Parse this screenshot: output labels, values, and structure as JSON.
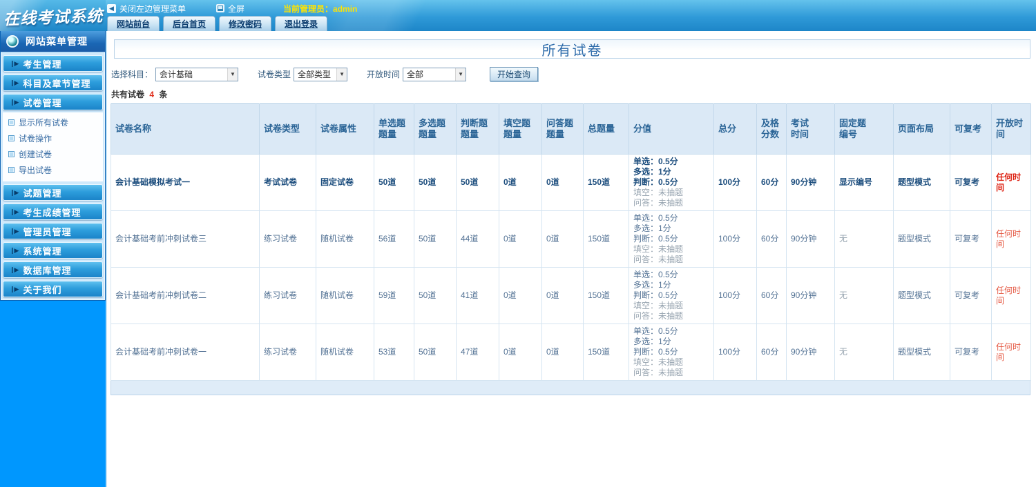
{
  "icons": {
    "menu_arrow": "❙▶",
    "close_menu": "◀",
    "select_arrow": "▼"
  },
  "topbar": {
    "logo": "在线考试系统",
    "close_menu_label": "关闭左边管理菜单",
    "fullscreen_label": "全屏",
    "admin_label": "当前管理员：admin",
    "tabs": [
      "网站前台",
      "后台首页",
      "修改密码",
      "退出登录"
    ]
  },
  "sidebar": {
    "title": "网站菜单管理",
    "items": [
      {
        "label": "考生管理"
      },
      {
        "label": "科目及章节管理"
      },
      {
        "label": "试卷管理",
        "children": [
          "显示所有试卷",
          "试卷操作",
          "创建试卷",
          "导出试卷"
        ]
      },
      {
        "label": "试题管理"
      },
      {
        "label": "考生成绩管理"
      },
      {
        "label": "管理员管理"
      },
      {
        "label": "系统管理"
      },
      {
        "label": "数据库管理"
      },
      {
        "label": "关于我们"
      }
    ]
  },
  "main": {
    "title": "所有试卷",
    "filters": {
      "subject_label": "选择科目：",
      "subject_value": "会计基础",
      "type_label": "试卷类型",
      "type_value": "全部类型",
      "time_label": "开放时间",
      "time_value": "全部",
      "query_button": "开始查询"
    },
    "count": {
      "prefix": "共有试卷",
      "value": "4",
      "suffix": "条"
    }
  },
  "table": {
    "columns": [
      "试卷名称",
      "试卷类型",
      "试卷属性",
      "单选题\n题量",
      "多选题\n题量",
      "判断题\n题量",
      "填空题\n题量",
      "问答题\n题量",
      "总题量",
      "分值",
      "总分",
      "及格\n分数",
      "考试\n时间",
      "固定题\n编号",
      "页面布局",
      "可复考",
      "开放时间"
    ],
    "rows": [
      {
        "bold": true,
        "name": "会计基础模拟考试一",
        "type": "考试试卷",
        "attr": "固定试卷",
        "single": "50道",
        "multi": "50道",
        "judge": "50道",
        "blank": "0道",
        "qa": "0道",
        "total": "150道",
        "score_lines": [
          "单选：0.5分",
          "多选：1分",
          "判断：0.5分"
        ],
        "score_muted": [
          "填空：未抽题",
          "问答：未抽题"
        ],
        "total_score": "100分",
        "pass_score": "60分",
        "time": "90分钟",
        "fixed_no": "显示编号",
        "fixed_no_muted": false,
        "layout": "题型模式",
        "retake": "可复考",
        "open_time": "任何时间"
      },
      {
        "bold": false,
        "name": "会计基础考前冲刺试卷三",
        "type": "练习试卷",
        "attr": "随机试卷",
        "single": "56道",
        "multi": "50道",
        "judge": "44道",
        "blank": "0道",
        "qa": "0道",
        "total": "150道",
        "score_lines": [
          "单选：0.5分",
          "多选：1分",
          "判断：0.5分"
        ],
        "score_muted": [
          "填空：未抽题",
          "问答：未抽题"
        ],
        "total_score": "100分",
        "pass_score": "60分",
        "time": "90分钟",
        "fixed_no": "无",
        "fixed_no_muted": true,
        "layout": "题型模式",
        "retake": "可复考",
        "open_time": "任何时间"
      },
      {
        "bold": false,
        "name": "会计基础考前冲刺试卷二",
        "type": "练习试卷",
        "attr": "随机试卷",
        "single": "59道",
        "multi": "50道",
        "judge": "41道",
        "blank": "0道",
        "qa": "0道",
        "total": "150道",
        "score_lines": [
          "单选：0.5分",
          "多选：1分",
          "判断：0.5分"
        ],
        "score_muted": [
          "填空：未抽题",
          "问答：未抽题"
        ],
        "total_score": "100分",
        "pass_score": "60分",
        "time": "90分钟",
        "fixed_no": "无",
        "fixed_no_muted": true,
        "layout": "题型模式",
        "retake": "可复考",
        "open_time": "任何时间"
      },
      {
        "bold": false,
        "name": "会计基础考前冲刺试卷一",
        "type": "练习试卷",
        "attr": "随机试卷",
        "single": "53道",
        "multi": "50道",
        "judge": "47道",
        "blank": "0道",
        "qa": "0道",
        "total": "150道",
        "score_lines": [
          "单选：0.5分",
          "多选：1分",
          "判断：0.5分"
        ],
        "score_muted": [
          "填空：未抽题",
          "问答：未抽题"
        ],
        "total_score": "100分",
        "pass_score": "60分",
        "time": "90分钟",
        "fixed_no": "无",
        "fixed_no_muted": true,
        "layout": "题型模式",
        "retake": "可复考",
        "open_time": "任何时间"
      }
    ]
  }
}
